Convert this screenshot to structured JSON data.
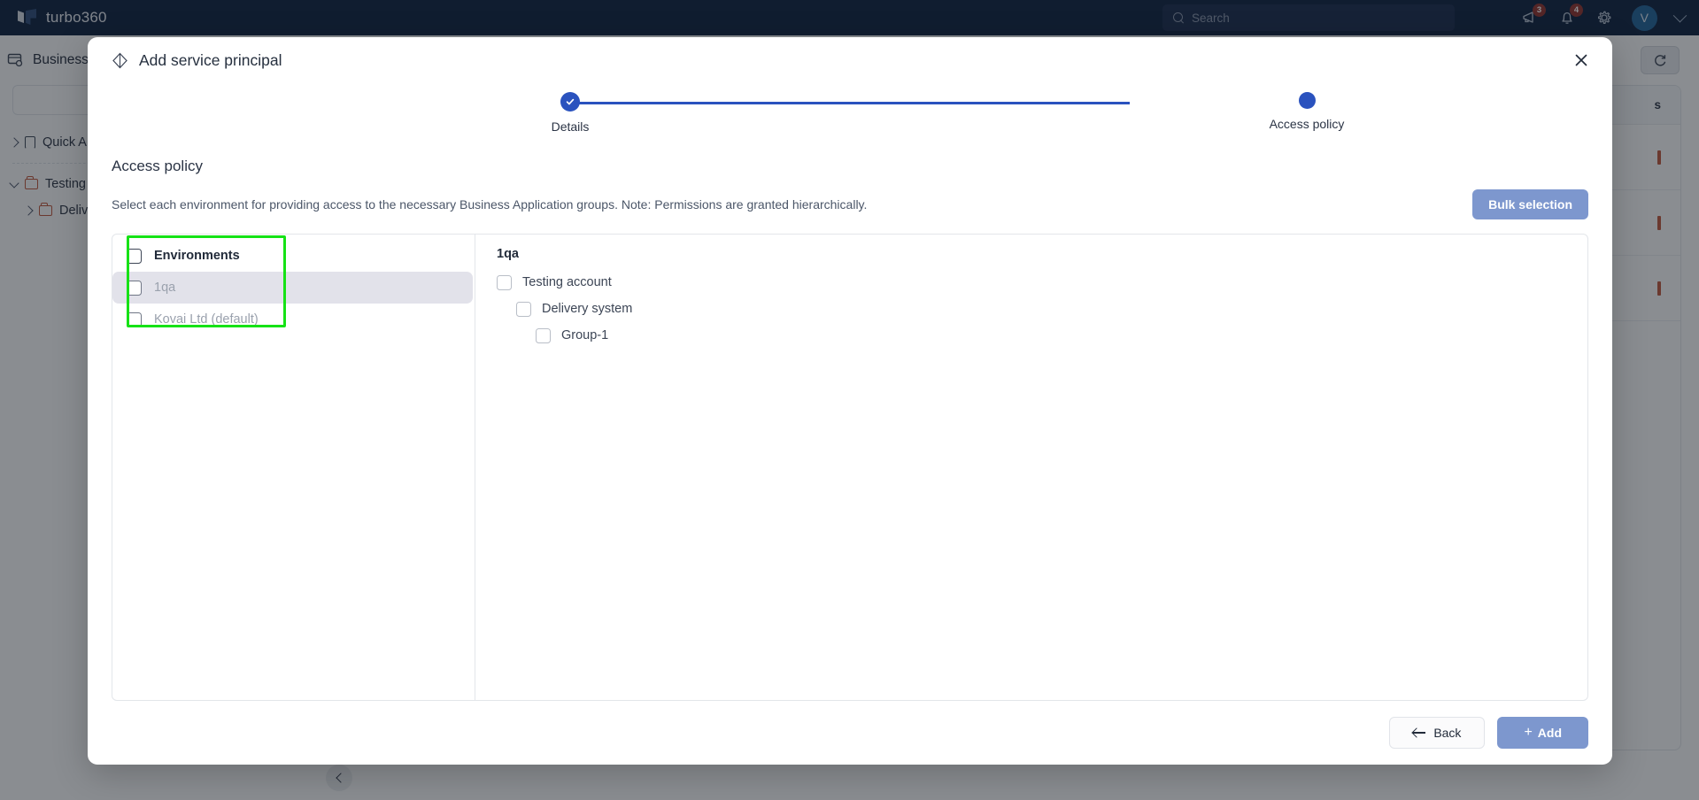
{
  "topbar": {
    "brand": "turbo360",
    "search_placeholder": "Search",
    "announcements_badge": "3",
    "notifications_badge": "4",
    "avatar_initial": "V",
    "icons": [
      "megaphone-icon",
      "bell-icon",
      "gear-icon",
      "chevron-down-icon"
    ]
  },
  "sidebar": {
    "title": "Business",
    "search_placeholder": "",
    "items": [
      {
        "label": "Quick A",
        "icon": "bookmark-icon",
        "expanded": false
      },
      {
        "label": "Testing",
        "icon": "folder-icon",
        "expanded": true
      },
      {
        "label": "Deliv",
        "icon": "folder-icon",
        "expanded": false
      }
    ]
  },
  "background": {
    "table_header": "s"
  },
  "modal": {
    "title": "Add service principal",
    "title_icon": "diamond-icon",
    "close_icon": "close-icon",
    "stepper": {
      "steps": [
        {
          "label": "Details",
          "state": "completed",
          "icon": "check-icon"
        },
        {
          "label": "Access policy",
          "state": "current",
          "icon": "dot-icon"
        }
      ]
    },
    "section": {
      "heading": "Access policy",
      "description": "Select each environment for providing access to the necessary Business Application groups. Note: Permissions are granted hierarchically.",
      "bulk_selection_label": "Bulk selection"
    },
    "environments_panel": {
      "header_label": "Environments",
      "rows": [
        {
          "label": "1qa",
          "selected": true,
          "checked": false
        },
        {
          "label": "Kovai Ltd (default)",
          "selected": false,
          "checked": false
        }
      ]
    },
    "tree_panel": {
      "title": "1qa",
      "nodes": [
        {
          "label": "Testing account",
          "level": 1,
          "checked": false
        },
        {
          "label": "Delivery system",
          "level": 2,
          "checked": false
        },
        {
          "label": "Group-1",
          "level": 3,
          "checked": false
        }
      ]
    },
    "footer": {
      "back_label": "Back",
      "add_label": "Add",
      "back_icon": "arrow-left-icon",
      "add_icon": "plus-icon"
    }
  },
  "colors": {
    "brand_navy": "#0b1e3d",
    "accent_blue": "#2a52be",
    "button_blue": "#7d97ce",
    "badge_red": "#93312b",
    "highlight_green": "#16e216",
    "row_selected": "#e2e2ea"
  }
}
